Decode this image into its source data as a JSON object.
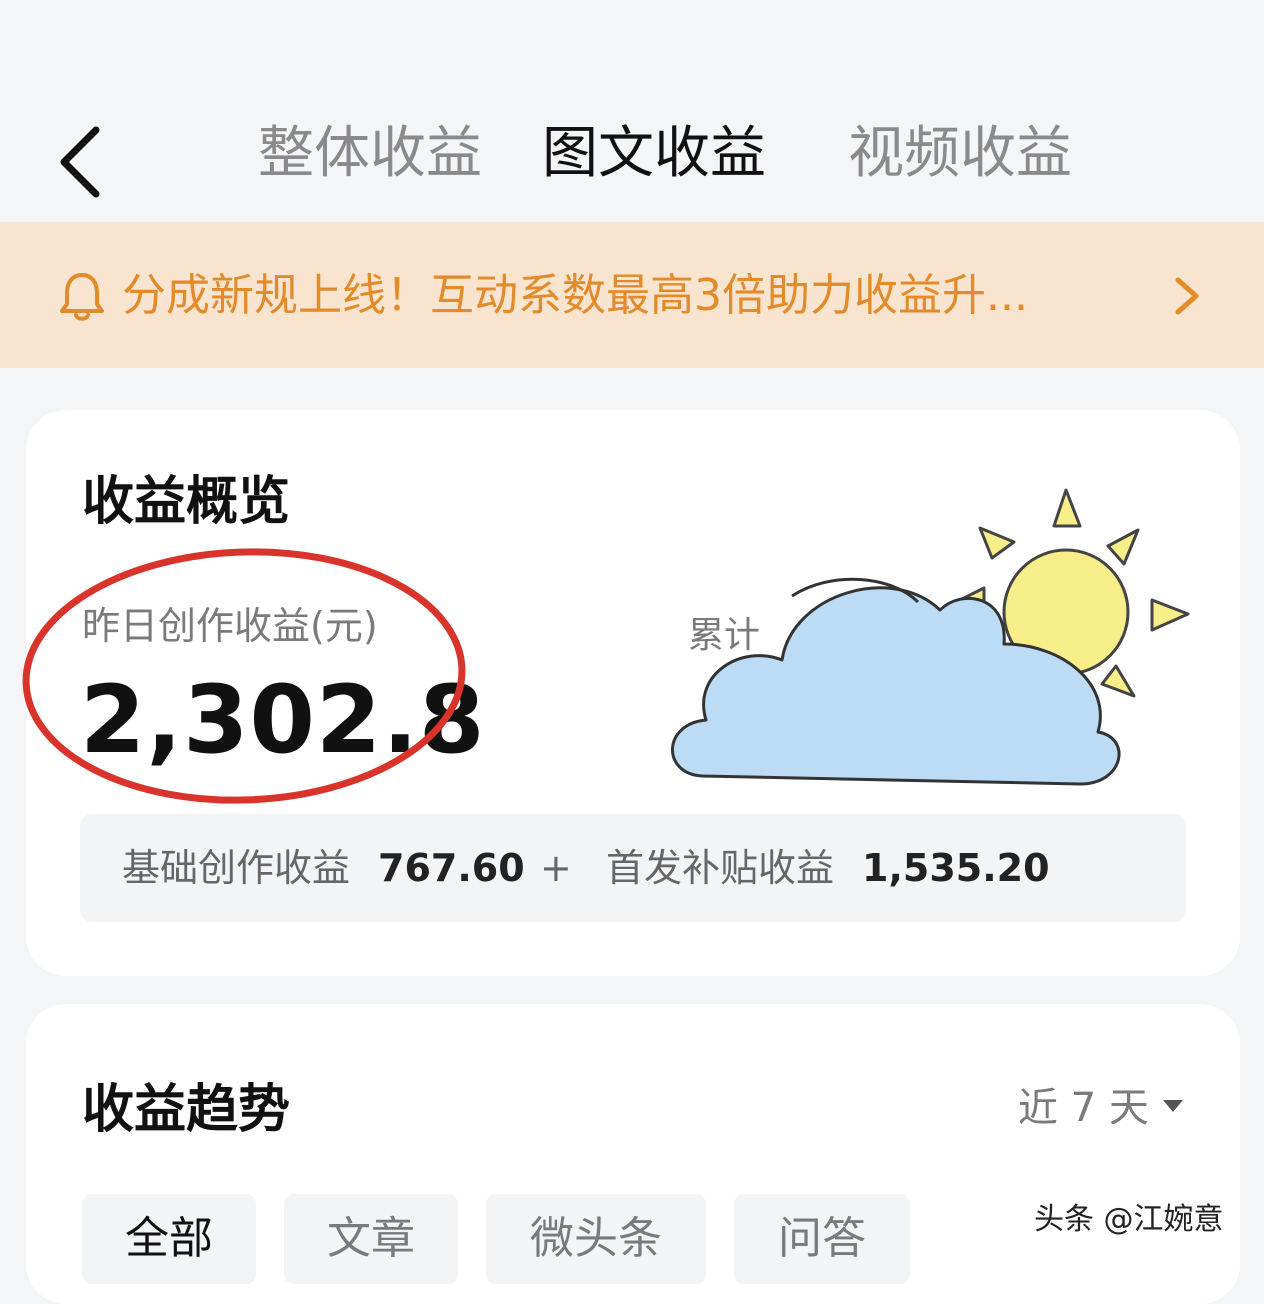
{
  "header": {
    "tabs": [
      {
        "label": "整体收益",
        "active": false
      },
      {
        "label": "图文收益",
        "active": true
      },
      {
        "label": "视频收益",
        "active": false
      }
    ],
    "back_icon": "chevron-left-icon"
  },
  "notice": {
    "text": "分成新规上线！互动系数最高3倍助力收益升...",
    "icon": "bell-icon",
    "arrow_icon": "chevron-right-icon",
    "color": "#e38a2a",
    "background": "#f8e4cf"
  },
  "overview": {
    "title": "收益概览",
    "yesterday_label": "昨日创作收益(元)",
    "yesterday_value": "2,302.8",
    "cumulative_label": "累计",
    "breakdown": {
      "base_label": "基础创作收益",
      "base_value": "767.60",
      "plus": "+",
      "first_label": "首发补贴收益",
      "first_value": "1,535.20"
    },
    "annotation_color": "#d9342b",
    "sticker": "sun-cloud-sticker"
  },
  "trend": {
    "title": "收益趋势",
    "range": "近 7 天",
    "filters": [
      {
        "label": "全部",
        "active": true
      },
      {
        "label": "文章",
        "active": false
      },
      {
        "label": "微头条",
        "active": false
      },
      {
        "label": "问答",
        "active": false
      }
    ]
  },
  "watermark": "头条 @江婉意"
}
